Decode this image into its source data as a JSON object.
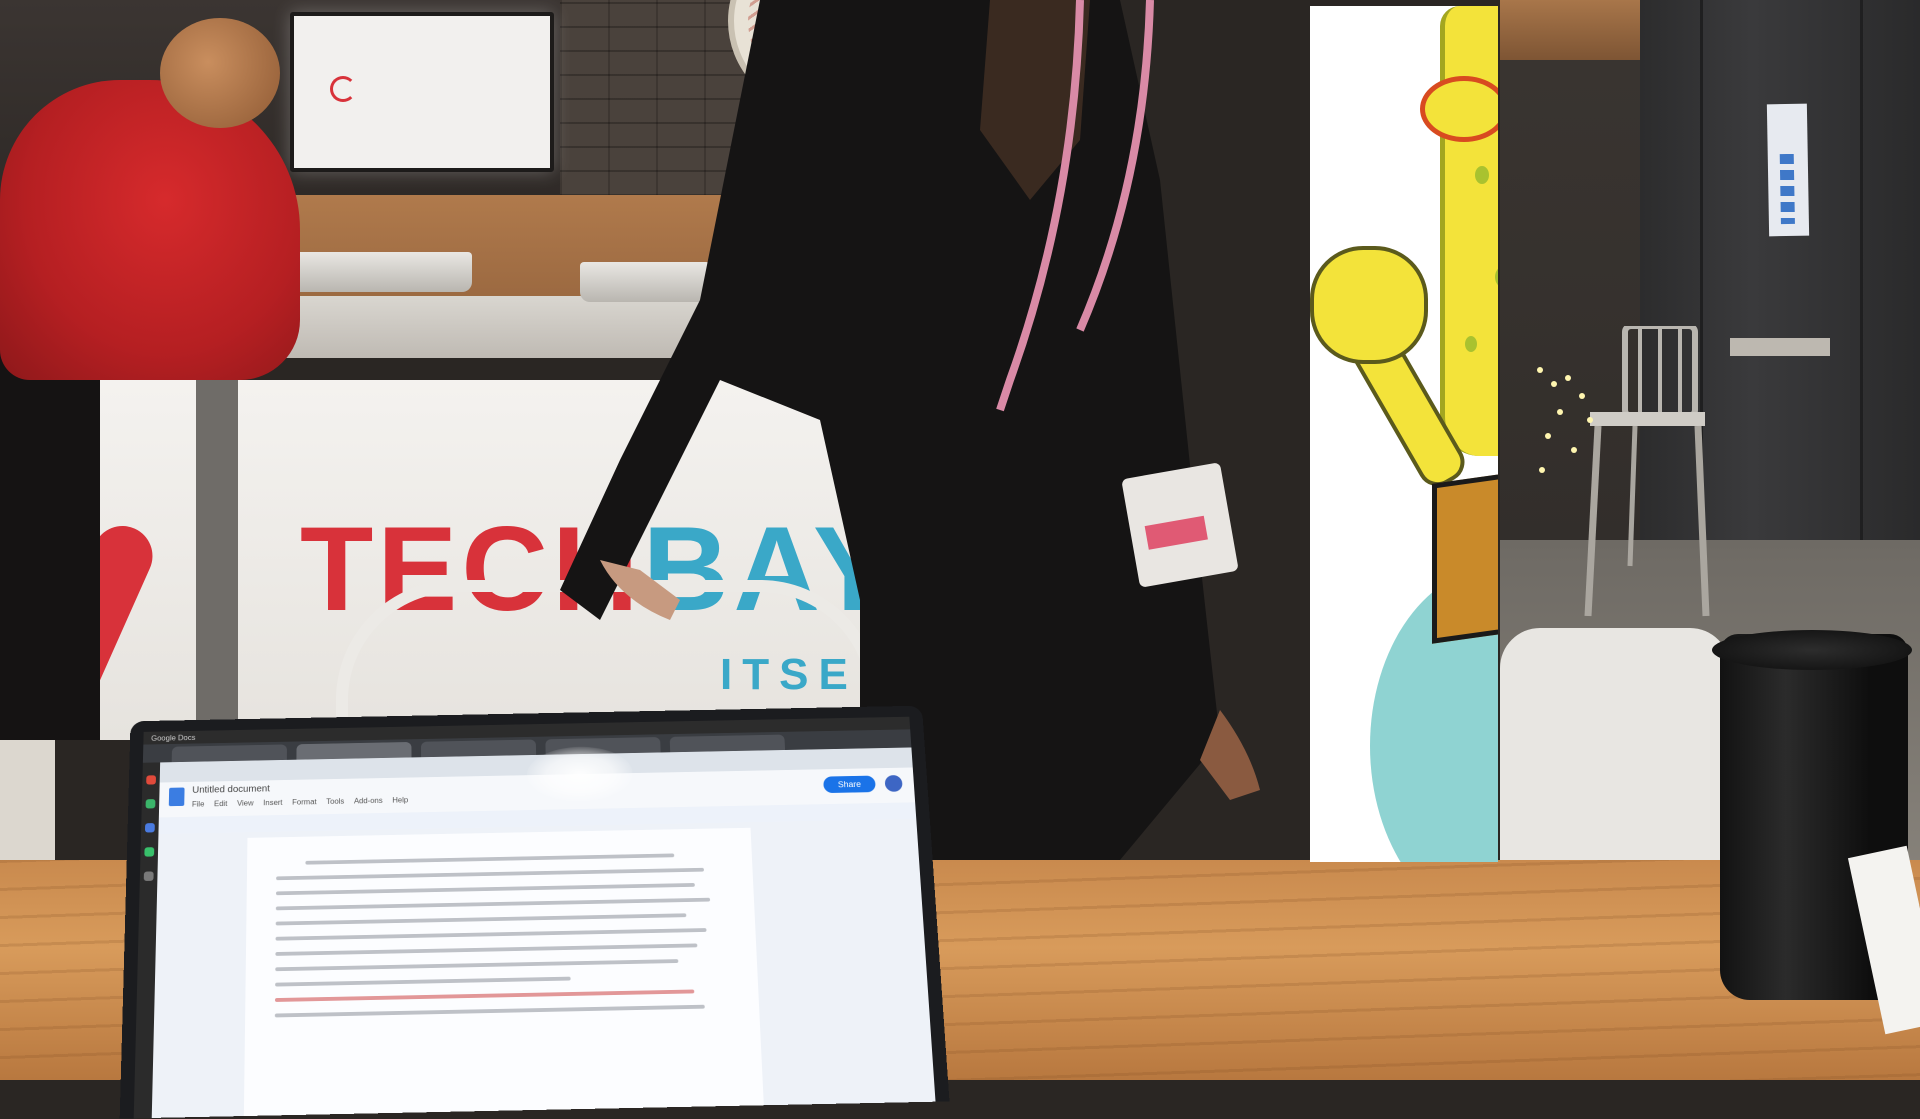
{
  "scene": {
    "sign": {
      "part1": "TECH",
      "part2": "BAY",
      "sub": "ITSE"
    },
    "laptop": {
      "window": "Google Docs",
      "doc_title": "Untitled document",
      "menu": [
        "File",
        "Edit",
        "View",
        "Insert",
        "Format",
        "Tools",
        "Add-ons",
        "Help"
      ],
      "share_label": "Share"
    }
  },
  "colors": {
    "brand_red": "#d8323a",
    "brand_blue": "#3aa8c8",
    "hoodie_red": "#c8262a",
    "cartoon_yellow": "#f3e33a",
    "cartoon_teal": "#8fd3d2",
    "table_wood": "#d89b5b"
  },
  "icons": [
    "google-docs-icon",
    "avatar-icon",
    "chrome-tab-icon"
  ]
}
